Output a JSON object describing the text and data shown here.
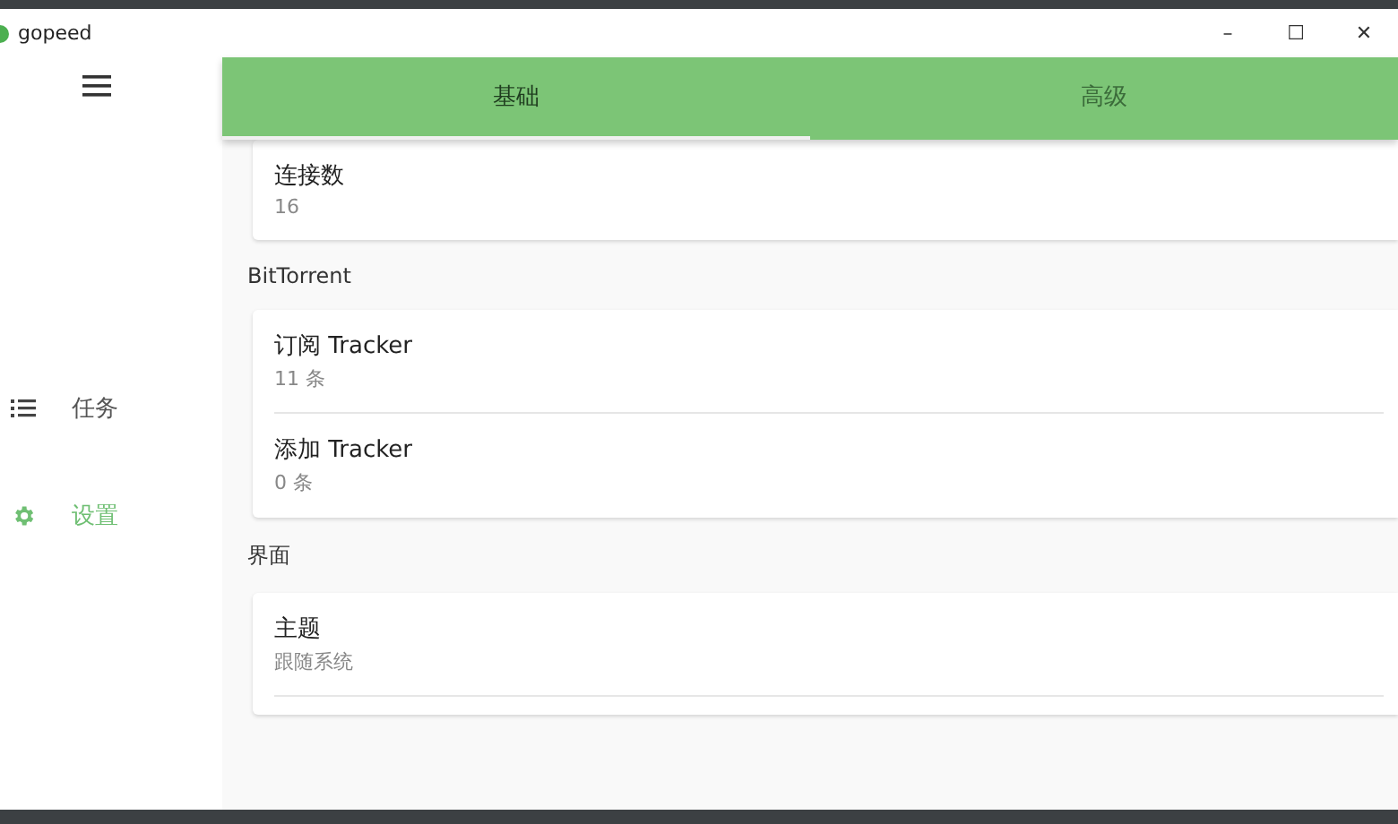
{
  "window": {
    "title": "gopeed",
    "controls": [
      "–",
      "☐",
      "✕"
    ]
  },
  "sidebar": {
    "items": [
      {
        "label": "任务",
        "kind": "list",
        "selected": false
      },
      {
        "label": "设置",
        "kind": "gear",
        "selected": true
      }
    ]
  },
  "tabs": [
    {
      "label": "基础",
      "selected": true
    },
    {
      "label": "高级",
      "selected": false
    }
  ],
  "sections": [
    {
      "items": [
        {
          "title": "连接数",
          "value": "16"
        }
      ]
    },
    {
      "header": "BitTorrent",
      "items": [
        {
          "title": "订阅 Tracker",
          "value": "11 条"
        },
        {
          "title": "添加 Tracker",
          "value": "0 条"
        }
      ]
    },
    {
      "header": "界面",
      "items": [
        {
          "title": "主题",
          "value": "跟随系统"
        }
      ]
    }
  ]
}
